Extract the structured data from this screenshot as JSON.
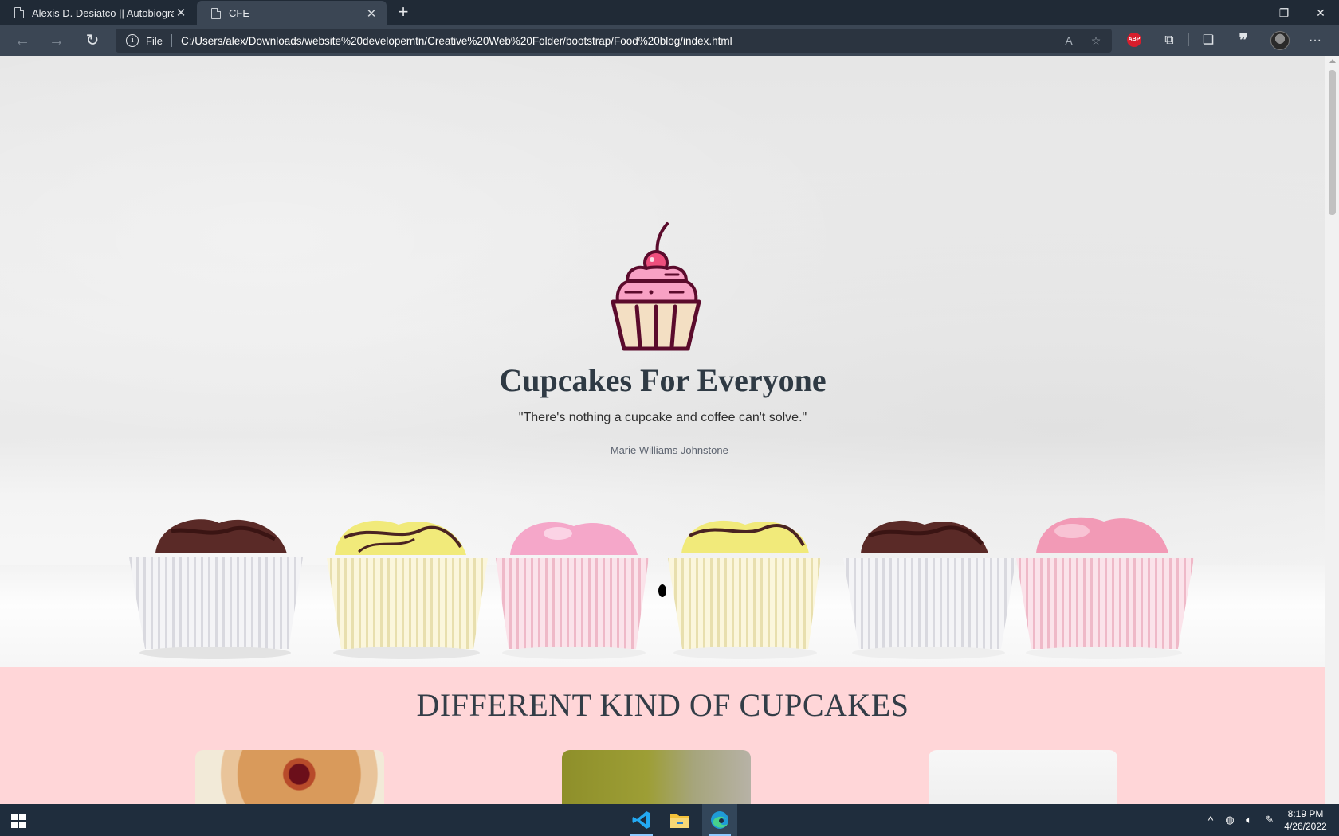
{
  "browser": {
    "tabs": [
      {
        "title": "Alexis D. Desiatco || Autobiograp",
        "active": false
      },
      {
        "title": "CFE",
        "active": true
      }
    ],
    "address": {
      "scheme_label": "File",
      "url": "C:/Users/alex/Downloads/website%20developemtn/Creative%20Web%20Folder/bootstrap/Food%20blog/index.html"
    },
    "extension_abp_label": "ABP"
  },
  "hero": {
    "title": "Cupcakes For Everyone",
    "quote": "\"There's nothing a cupcake and coffee can't solve.\"",
    "author": "— Marie Williams Johnstone"
  },
  "section": {
    "title": "DIFFERENT KIND OF CUPCAKES",
    "cards": [
      {
        "name": "cupcake-card-1"
      },
      {
        "name": "cupcake-card-2"
      },
      {
        "name": "cupcake-card-3"
      }
    ]
  },
  "taskbar": {
    "apps": [
      "vscode-icon",
      "file-explorer-icon",
      "edge-icon"
    ],
    "time": "8:19 PM",
    "date": "4/26/2022"
  },
  "colors": {
    "section_bg": "#ffd6d8",
    "title_text": "#2f3a44",
    "logo_cherry": "#ee4f7d",
    "logo_outline": "#5b0b2c",
    "logo_frosting": "#f8a1c4",
    "logo_liner": "#f3dfc3"
  }
}
